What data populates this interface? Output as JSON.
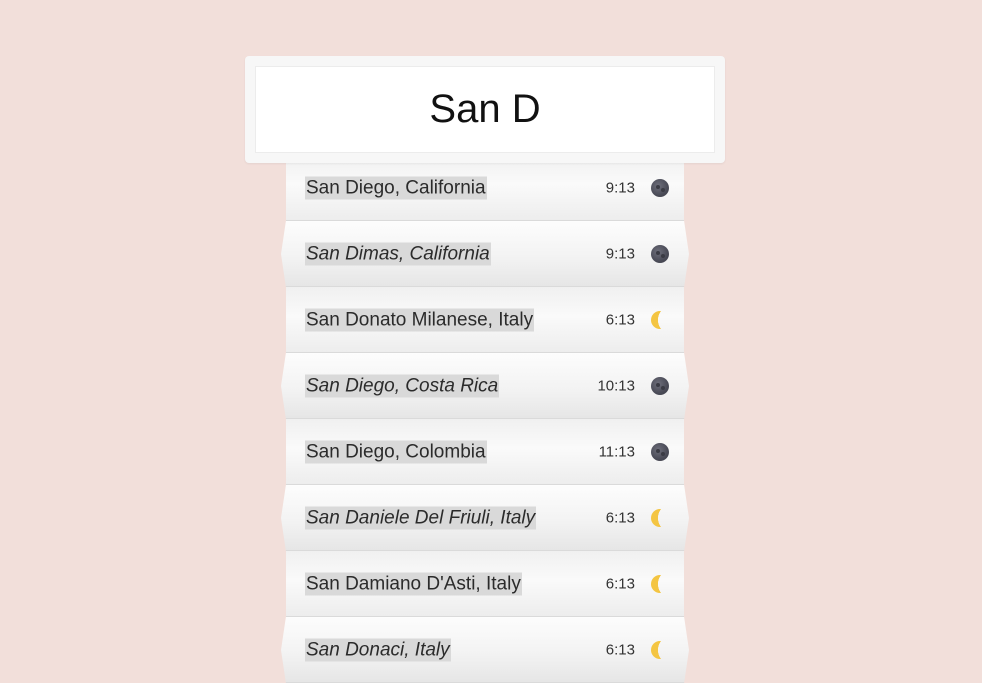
{
  "search": {
    "value": "San D",
    "placeholder": ""
  },
  "results": [
    {
      "name": "San Diego, California",
      "time": "9:13",
      "icon": "new-moon-icon"
    },
    {
      "name": "San Dimas, California",
      "time": "9:13",
      "icon": "new-moon-icon"
    },
    {
      "name": "San Donato Milanese, Italy",
      "time": "6:13",
      "icon": "crescent-moon-icon"
    },
    {
      "name": "San Diego, Costa Rica",
      "time": "10:13",
      "icon": "new-moon-icon"
    },
    {
      "name": "San Diego, Colombia",
      "time": "11:13",
      "icon": "new-moon-icon"
    },
    {
      "name": "San Daniele Del Friuli, Italy",
      "time": "6:13",
      "icon": "crescent-moon-icon"
    },
    {
      "name": "San Damiano D'Asti, Italy",
      "time": "6:13",
      "icon": "crescent-moon-icon"
    },
    {
      "name": "San Donaci, Italy",
      "time": "6:13",
      "icon": "crescent-moon-icon"
    }
  ],
  "colors": {
    "background": "#f2dfda",
    "highlight": "#d9d9d9",
    "crescent": "#f4c542",
    "new_moon": "#4a4b57"
  }
}
